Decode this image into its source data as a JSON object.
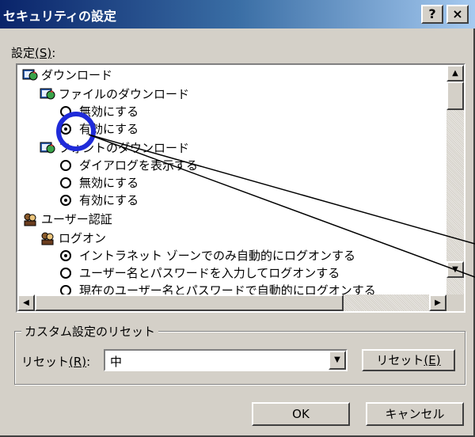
{
  "window": {
    "title": "セキュリティの設定",
    "help_label": "?",
    "close_label": "×"
  },
  "settings": {
    "label": "設定",
    "accel": "(S)",
    "suffix": ":",
    "items": [
      {
        "type": "node",
        "icon": "globe-user-icon",
        "label": "ダウンロード"
      },
      {
        "type": "node",
        "icon": "globe-user-icon",
        "label": "ファイルのダウンロード"
      },
      {
        "type": "radio",
        "selected": false,
        "label": "無効にする"
      },
      {
        "type": "radio",
        "selected": true,
        "label": "有効にする"
      },
      {
        "type": "node",
        "icon": "globe-user-icon",
        "label": "フォントのダウンロード"
      },
      {
        "type": "radio",
        "selected": false,
        "label": "ダイアログを表示する"
      },
      {
        "type": "radio",
        "selected": false,
        "label": "無効にする"
      },
      {
        "type": "radio",
        "selected": true,
        "label": "有効にする"
      },
      {
        "type": "node",
        "icon": "user-auth-icon",
        "label": "ユーザー認証"
      },
      {
        "type": "node",
        "icon": "user-auth-icon",
        "label": "ログオン"
      },
      {
        "type": "radio",
        "selected": true,
        "label": "イントラネット ゾーンでのみ自動的にログオンする"
      },
      {
        "type": "radio",
        "selected": false,
        "label": "ユーザー名とパスワードを入力してログオンする"
      },
      {
        "type": "radio",
        "selected": false,
        "label": "現在のユーザー名とパスワードで自動的にログオンする"
      }
    ]
  },
  "reset_group": {
    "title": "カスタム設定のリセット",
    "label": "リセット",
    "accel": "(R)",
    "suffix": ":",
    "value": "中",
    "button_label": "リセット",
    "button_accel": "(E)"
  },
  "buttons": {
    "ok": "OK",
    "cancel": "キャンセル"
  },
  "annotation": {
    "highlight_color": "#1f2bd9"
  }
}
